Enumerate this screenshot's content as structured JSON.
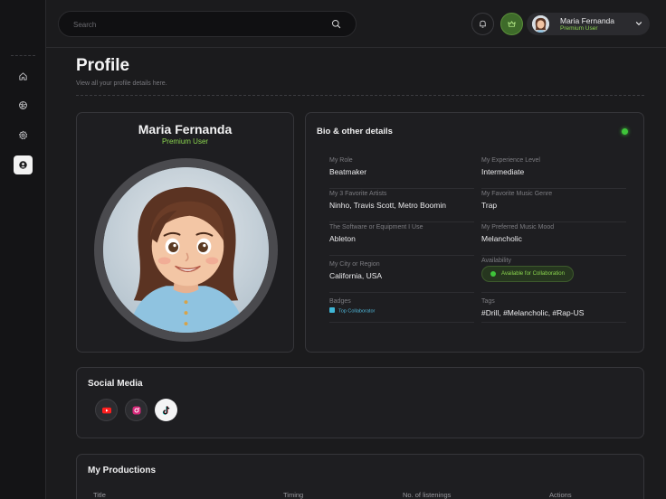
{
  "search": {
    "placeholder": "Search"
  },
  "user": {
    "name": "Maria Fernanda",
    "tier": "Premium User"
  },
  "header": {
    "title": "Profile",
    "subtitle": "View all your profile details here."
  },
  "profile": {
    "name": "Maria Fernanda",
    "tier": "Premium User"
  },
  "bio": {
    "title": "Bio & other details",
    "fields": [
      {
        "label": "My Role",
        "value": "Beatmaker"
      },
      {
        "label": "My Experience Level",
        "value": "Intermediate"
      },
      {
        "label": "My 3 Favorite Artists",
        "value": "Ninho, Travis Scott, Metro Boomin"
      },
      {
        "label": "My Favorite Music Genre",
        "value": "Trap"
      },
      {
        "label": "The Software or Equipment I Use",
        "value": "Ableton"
      },
      {
        "label": "My Preferred Music Mood",
        "value": "Melancholic"
      },
      {
        "label": "My City or Region",
        "value": "California, USA"
      },
      {
        "label": "Availability",
        "value": "Available for Collaboration"
      },
      {
        "label": "Badges",
        "value": "Top Collaborator"
      },
      {
        "label": "Tags",
        "value": "#Drill, #Melancholic, #Rap-US"
      }
    ]
  },
  "social": {
    "title": "Social Media",
    "icons": [
      "youtube-icon",
      "instagram-icon",
      "tiktok-icon"
    ]
  },
  "productions": {
    "title": "My Productions",
    "columns": [
      "Title",
      "Timing",
      "No. of listenings",
      "Actions"
    ]
  },
  "colors": {
    "accent": "#8ad44e",
    "status": "#3fc43a",
    "background": "#1b1b1d"
  }
}
